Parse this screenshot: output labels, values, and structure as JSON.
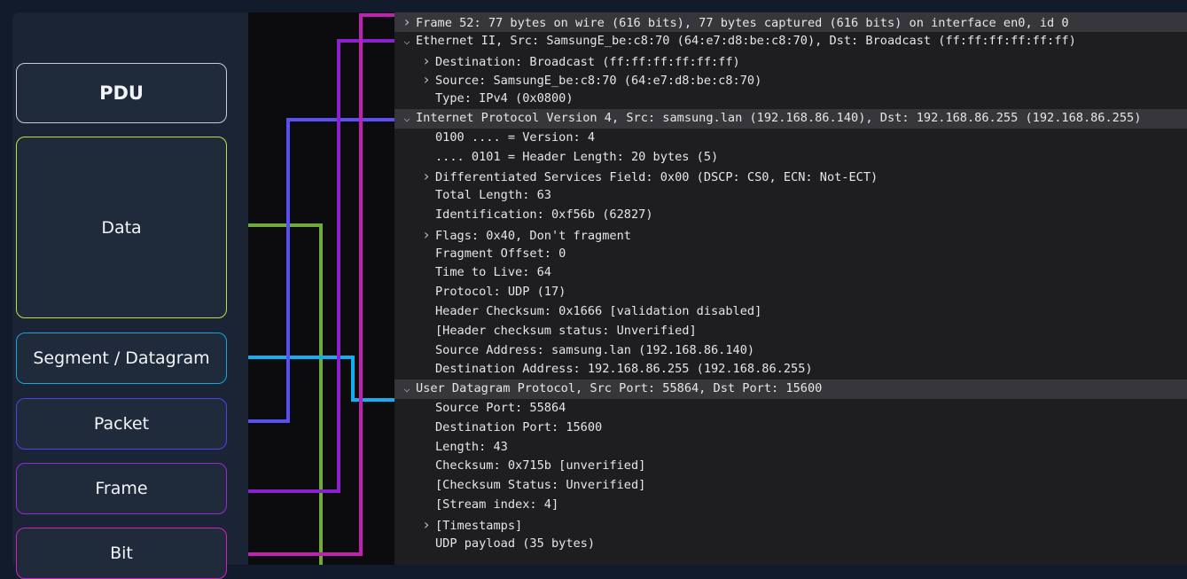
{
  "colors": {
    "data": "#6fab3c",
    "segment": "#12aef0",
    "packet": "#5a4ff5",
    "frame": "#8a22cc",
    "bit": "#c21fb4"
  },
  "pdu": {
    "header": "PDU",
    "data": "Data",
    "segment": "Segment / Datagram",
    "packet": "Packet",
    "frame": "Frame",
    "bit": "Bit"
  },
  "packet_details": [
    {
      "text": "Frame 52: 77 bytes on wire (616 bits), 77 bytes captured (616 bits) on interface en0, id 0",
      "indent": 0,
      "toggle": "closed",
      "selected": true
    },
    {
      "text": "Ethernet II, Src: SamsungE_be:c8:70 (64:e7:d8:be:c8:70), Dst: Broadcast (ff:ff:ff:ff:ff:ff)",
      "indent": 0,
      "toggle": "open",
      "selected": false
    },
    {
      "text": "Destination: Broadcast (ff:ff:ff:ff:ff:ff)",
      "indent": 1,
      "toggle": "closed",
      "selected": false
    },
    {
      "text": "Source: SamsungE_be:c8:70 (64:e7:d8:be:c8:70)",
      "indent": 1,
      "toggle": "closed",
      "selected": false
    },
    {
      "text": "Type: IPv4 (0x0800)",
      "indent": 1,
      "toggle": "none",
      "selected": false
    },
    {
      "text": "Internet Protocol Version 4, Src: samsung.lan (192.168.86.140), Dst: 192.168.86.255 (192.168.86.255)",
      "indent": 0,
      "toggle": "open",
      "selected": true
    },
    {
      "text": "0100 .... = Version: 4",
      "indent": 1,
      "toggle": "none",
      "selected": false
    },
    {
      "text": ".... 0101 = Header Length: 20 bytes (5)",
      "indent": 1,
      "toggle": "none",
      "selected": false
    },
    {
      "text": "Differentiated Services Field: 0x00 (DSCP: CS0, ECN: Not-ECT)",
      "indent": 1,
      "toggle": "closed",
      "selected": false
    },
    {
      "text": "Total Length: 63",
      "indent": 1,
      "toggle": "none",
      "selected": false
    },
    {
      "text": "Identification: 0xf56b (62827)",
      "indent": 1,
      "toggle": "none",
      "selected": false
    },
    {
      "text": "Flags: 0x40, Don't fragment",
      "indent": 1,
      "toggle": "closed",
      "selected": false
    },
    {
      "text": "Fragment Offset: 0",
      "indent": 1,
      "toggle": "none",
      "selected": false
    },
    {
      "text": "Time to Live: 64",
      "indent": 1,
      "toggle": "none",
      "selected": false
    },
    {
      "text": "Protocol: UDP (17)",
      "indent": 1,
      "toggle": "none",
      "selected": false
    },
    {
      "text": "Header Checksum: 0x1666 [validation disabled]",
      "indent": 1,
      "toggle": "none",
      "selected": false
    },
    {
      "text": "[Header checksum status: Unverified]",
      "indent": 1,
      "toggle": "none",
      "selected": false
    },
    {
      "text": "Source Address: samsung.lan (192.168.86.140)",
      "indent": 1,
      "toggle": "none",
      "selected": false
    },
    {
      "text": "Destination Address: 192.168.86.255 (192.168.86.255)",
      "indent": 1,
      "toggle": "none",
      "selected": false
    },
    {
      "text": "User Datagram Protocol, Src Port: 55864, Dst Port: 15600",
      "indent": 0,
      "toggle": "open",
      "selected": true
    },
    {
      "text": "Source Port: 55864",
      "indent": 1,
      "toggle": "none",
      "selected": false
    },
    {
      "text": "Destination Port: 15600",
      "indent": 1,
      "toggle": "none",
      "selected": false
    },
    {
      "text": "Length: 43",
      "indent": 1,
      "toggle": "none",
      "selected": false
    },
    {
      "text": "Checksum: 0x715b [unverified]",
      "indent": 1,
      "toggle": "none",
      "selected": false
    },
    {
      "text": "[Checksum Status: Unverified]",
      "indent": 1,
      "toggle": "none",
      "selected": false
    },
    {
      "text": "[Stream index: 4]",
      "indent": 1,
      "toggle": "none",
      "selected": false
    },
    {
      "text": "[Timestamps]",
      "indent": 1,
      "toggle": "closed",
      "selected": false
    },
    {
      "text": "UDP payload (35 bytes)",
      "indent": 1,
      "toggle": "none",
      "selected": false
    }
  ]
}
